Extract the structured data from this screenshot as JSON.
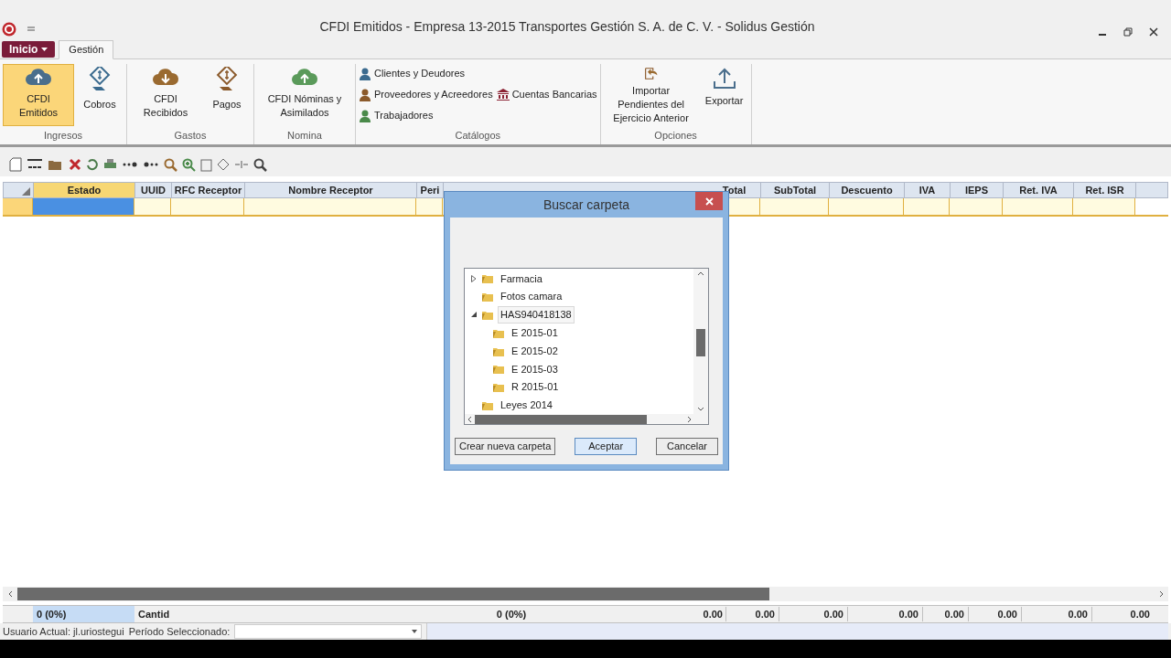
{
  "window": {
    "title": "CFDI Emitidos - Empresa 13-2015 Transportes Gestión S. A. de C. V. - Solidus Gestión"
  },
  "menu_button": "Inicio",
  "tabs": [
    {
      "label": "Gestión",
      "selected": true
    }
  ],
  "ribbon": {
    "groups": [
      {
        "label": "Ingresos",
        "items": [
          {
            "label": "CFDI Emitidos",
            "kind": "cloud-up",
            "selected": true
          },
          {
            "label": "Cobros",
            "kind": "money",
            "selected": false
          }
        ]
      },
      {
        "label": "Gastos",
        "items": [
          {
            "label": "CFDI Recibidos",
            "kind": "cloud-down",
            "selected": false
          },
          {
            "label": "Pagos",
            "kind": "money-brown",
            "selected": false
          }
        ]
      },
      {
        "label": "Nomina",
        "items": [
          {
            "label": "CFDI Nóminas y Asimilados",
            "kind": "cloud-green",
            "selected": false
          }
        ]
      },
      {
        "label": "Catálogos",
        "items": [
          {
            "label": "Clientes y Deudores",
            "kind": "person-blue",
            "selected": false
          },
          {
            "label": "Proveedores y Acreedores",
            "kind": "person-brown",
            "selected": false
          },
          {
            "label": "Trabajadores",
            "kind": "person-green",
            "selected": false
          },
          {
            "label": "Cuentas Bancarias",
            "kind": "bank",
            "selected": false
          }
        ]
      },
      {
        "label": "Opciones",
        "items": [
          {
            "label": "Importar Pendientes del Ejercicio Anterior",
            "kind": "import",
            "selected": false
          },
          {
            "label": "Exportar",
            "kind": "export",
            "selected": false
          }
        ]
      }
    ]
  },
  "grid": {
    "columns": [
      {
        "label": "Estado",
        "selected": true
      },
      {
        "label": "UUID",
        "selected": false
      },
      {
        "label": "RFC Receptor",
        "selected": false
      },
      {
        "label": "Nombre Receptor",
        "selected": false
      },
      {
        "label": "Peri",
        "selected": false
      },
      {
        "label": "Total",
        "selected": false
      },
      {
        "label": "SubTotal",
        "selected": false
      },
      {
        "label": "Descuento",
        "selected": false
      },
      {
        "label": "IVA",
        "selected": false
      },
      {
        "label": "IEPS",
        "selected": false
      },
      {
        "label": "Ret. IVA",
        "selected": false
      },
      {
        "label": "Ret. ISR",
        "selected": false
      }
    ],
    "totals": {
      "count": "0 (0%)",
      "label": "Cantid",
      "second_count": "0 (0%)",
      "values": [
        "0.00",
        "0.00",
        "0.00",
        "0.00",
        "0.00",
        "0.00",
        "0.00",
        "0.00"
      ]
    }
  },
  "dialog": {
    "title": "Buscar carpeta",
    "tree": [
      {
        "label": "Farmacia",
        "expanded": false,
        "selected": false
      },
      {
        "label": "Fotos camara",
        "selected": false
      },
      {
        "label": "HAS940418138",
        "expanded": true,
        "selected": true,
        "children": [
          {
            "label": "E 2015-01",
            "selected": false
          },
          {
            "label": "E 2015-02",
            "selected": false
          },
          {
            "label": "E 2015-03",
            "selected": false
          },
          {
            "label": "R 2015-01",
            "selected": false
          }
        ]
      },
      {
        "label": "Leyes 2014",
        "selected": false
      }
    ],
    "buttons": [
      {
        "label": "Crear nueva carpeta",
        "selected": false
      },
      {
        "label": "Aceptar",
        "selected": true
      },
      {
        "label": "Cancelar",
        "selected": false
      }
    ]
  },
  "status_bar": {
    "user": "Usuario Actual: jl.uriostegui",
    "period_label": "Período Seleccionado:"
  }
}
